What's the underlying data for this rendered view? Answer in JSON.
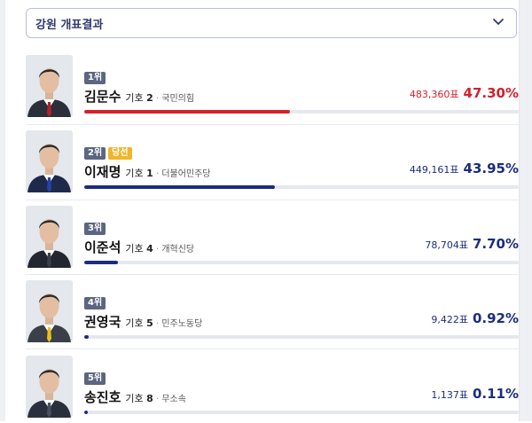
{
  "region": {
    "label": "강원 개표결과"
  },
  "candidates": [
    {
      "rank": "1위",
      "elected": "",
      "name": "김문수",
      "num_prefix": "기호",
      "num": "2",
      "party": "국민의힘",
      "votes": "483,360표",
      "percent": "47.30%",
      "pct_value": 47.3,
      "color": "#d4202c",
      "suit": "#2b2f3a",
      "tie": "#b4202a"
    },
    {
      "rank": "2위",
      "elected": "당선",
      "name": "이재명",
      "num_prefix": "기호",
      "num": "1",
      "party": "더불어민주당",
      "votes": "449,161표",
      "percent": "43.95%",
      "pct_value": 43.95,
      "color": "#1b2d7d",
      "suit": "#1f2a4a",
      "tie": "#2444a8"
    },
    {
      "rank": "3위",
      "elected": "",
      "name": "이준석",
      "num_prefix": "기호",
      "num": "4",
      "party": "개혁신당",
      "votes": "78,704표",
      "percent": "7.70%",
      "pct_value": 7.7,
      "color": "#1b2d7d",
      "suit": "#22262e",
      "tie": "#3a3f4a"
    },
    {
      "rank": "4위",
      "elected": "",
      "name": "권영국",
      "num_prefix": "기호",
      "num": "5",
      "party": "민주노동당",
      "votes": "9,422표",
      "percent": "0.92%",
      "pct_value": 0.92,
      "color": "#1b2d7d",
      "suit": "#3a3f48",
      "tie": "#e8c21a"
    },
    {
      "rank": "5위",
      "elected": "",
      "name": "송진호",
      "num_prefix": "기호",
      "num": "8",
      "party": "무소속",
      "votes": "1,137표",
      "percent": "0.11%",
      "pct_value": 0.11,
      "color": "#1b2d7d",
      "suit": "#2a2f3c",
      "tie": "#4a4f5e"
    }
  ]
}
